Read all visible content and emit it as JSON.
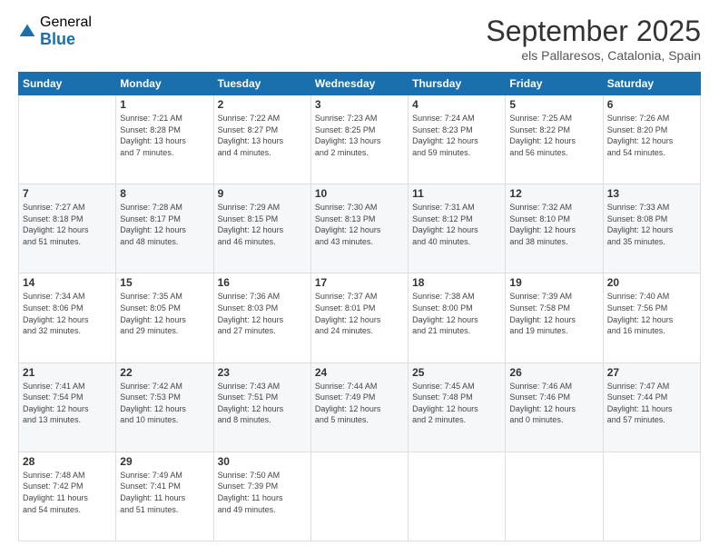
{
  "logo": {
    "general": "General",
    "blue": "Blue"
  },
  "header": {
    "month": "September 2025",
    "location": "els Pallaresos, Catalonia, Spain"
  },
  "days_of_week": [
    "Sunday",
    "Monday",
    "Tuesday",
    "Wednesday",
    "Thursday",
    "Friday",
    "Saturday"
  ],
  "weeks": [
    [
      {
        "day": "",
        "info": ""
      },
      {
        "day": "1",
        "info": "Sunrise: 7:21 AM\nSunset: 8:28 PM\nDaylight: 13 hours\nand 7 minutes."
      },
      {
        "day": "2",
        "info": "Sunrise: 7:22 AM\nSunset: 8:27 PM\nDaylight: 13 hours\nand 4 minutes."
      },
      {
        "day": "3",
        "info": "Sunrise: 7:23 AM\nSunset: 8:25 PM\nDaylight: 13 hours\nand 2 minutes."
      },
      {
        "day": "4",
        "info": "Sunrise: 7:24 AM\nSunset: 8:23 PM\nDaylight: 12 hours\nand 59 minutes."
      },
      {
        "day": "5",
        "info": "Sunrise: 7:25 AM\nSunset: 8:22 PM\nDaylight: 12 hours\nand 56 minutes."
      },
      {
        "day": "6",
        "info": "Sunrise: 7:26 AM\nSunset: 8:20 PM\nDaylight: 12 hours\nand 54 minutes."
      }
    ],
    [
      {
        "day": "7",
        "info": "Sunrise: 7:27 AM\nSunset: 8:18 PM\nDaylight: 12 hours\nand 51 minutes."
      },
      {
        "day": "8",
        "info": "Sunrise: 7:28 AM\nSunset: 8:17 PM\nDaylight: 12 hours\nand 48 minutes."
      },
      {
        "day": "9",
        "info": "Sunrise: 7:29 AM\nSunset: 8:15 PM\nDaylight: 12 hours\nand 46 minutes."
      },
      {
        "day": "10",
        "info": "Sunrise: 7:30 AM\nSunset: 8:13 PM\nDaylight: 12 hours\nand 43 minutes."
      },
      {
        "day": "11",
        "info": "Sunrise: 7:31 AM\nSunset: 8:12 PM\nDaylight: 12 hours\nand 40 minutes."
      },
      {
        "day": "12",
        "info": "Sunrise: 7:32 AM\nSunset: 8:10 PM\nDaylight: 12 hours\nand 38 minutes."
      },
      {
        "day": "13",
        "info": "Sunrise: 7:33 AM\nSunset: 8:08 PM\nDaylight: 12 hours\nand 35 minutes."
      }
    ],
    [
      {
        "day": "14",
        "info": "Sunrise: 7:34 AM\nSunset: 8:06 PM\nDaylight: 12 hours\nand 32 minutes."
      },
      {
        "day": "15",
        "info": "Sunrise: 7:35 AM\nSunset: 8:05 PM\nDaylight: 12 hours\nand 29 minutes."
      },
      {
        "day": "16",
        "info": "Sunrise: 7:36 AM\nSunset: 8:03 PM\nDaylight: 12 hours\nand 27 minutes."
      },
      {
        "day": "17",
        "info": "Sunrise: 7:37 AM\nSunset: 8:01 PM\nDaylight: 12 hours\nand 24 minutes."
      },
      {
        "day": "18",
        "info": "Sunrise: 7:38 AM\nSunset: 8:00 PM\nDaylight: 12 hours\nand 21 minutes."
      },
      {
        "day": "19",
        "info": "Sunrise: 7:39 AM\nSunset: 7:58 PM\nDaylight: 12 hours\nand 19 minutes."
      },
      {
        "day": "20",
        "info": "Sunrise: 7:40 AM\nSunset: 7:56 PM\nDaylight: 12 hours\nand 16 minutes."
      }
    ],
    [
      {
        "day": "21",
        "info": "Sunrise: 7:41 AM\nSunset: 7:54 PM\nDaylight: 12 hours\nand 13 minutes."
      },
      {
        "day": "22",
        "info": "Sunrise: 7:42 AM\nSunset: 7:53 PM\nDaylight: 12 hours\nand 10 minutes."
      },
      {
        "day": "23",
        "info": "Sunrise: 7:43 AM\nSunset: 7:51 PM\nDaylight: 12 hours\nand 8 minutes."
      },
      {
        "day": "24",
        "info": "Sunrise: 7:44 AM\nSunset: 7:49 PM\nDaylight: 12 hours\nand 5 minutes."
      },
      {
        "day": "25",
        "info": "Sunrise: 7:45 AM\nSunset: 7:48 PM\nDaylight: 12 hours\nand 2 minutes."
      },
      {
        "day": "26",
        "info": "Sunrise: 7:46 AM\nSunset: 7:46 PM\nDaylight: 12 hours\nand 0 minutes."
      },
      {
        "day": "27",
        "info": "Sunrise: 7:47 AM\nSunset: 7:44 PM\nDaylight: 11 hours\nand 57 minutes."
      }
    ],
    [
      {
        "day": "28",
        "info": "Sunrise: 7:48 AM\nSunset: 7:42 PM\nDaylight: 11 hours\nand 54 minutes."
      },
      {
        "day": "29",
        "info": "Sunrise: 7:49 AM\nSunset: 7:41 PM\nDaylight: 11 hours\nand 51 minutes."
      },
      {
        "day": "30",
        "info": "Sunrise: 7:50 AM\nSunset: 7:39 PM\nDaylight: 11 hours\nand 49 minutes."
      },
      {
        "day": "",
        "info": ""
      },
      {
        "day": "",
        "info": ""
      },
      {
        "day": "",
        "info": ""
      },
      {
        "day": "",
        "info": ""
      }
    ]
  ]
}
